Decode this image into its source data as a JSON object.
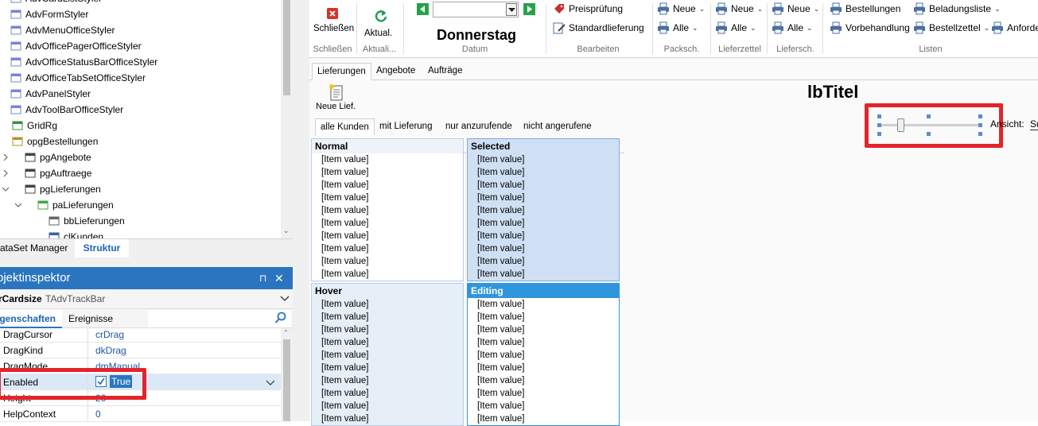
{
  "tree": {
    "items": [
      {
        "label": "AdvCardListStyler",
        "icon": "component-icon"
      },
      {
        "label": "AdvFormStyler",
        "icon": "component-icon"
      },
      {
        "label": "AdvMenuOfficeStyler",
        "icon": "component-icon"
      },
      {
        "label": "AdvOfficePagerOfficeStyler",
        "icon": "component-icon"
      },
      {
        "label": "AdvOfficeStatusBarOfficeStyler",
        "icon": "component-icon"
      },
      {
        "label": "AdvOfficeTabSetOfficeStyler",
        "icon": "component-icon"
      },
      {
        "label": "AdvPanelStyler",
        "icon": "component-icon"
      },
      {
        "label": "AdvToolBarOfficeStyler",
        "icon": "component-icon"
      },
      {
        "label": "GridRg",
        "icon": "grid-icon"
      },
      {
        "label": "opgBestellungen",
        "icon": "pager-icon"
      },
      {
        "label": "pgAngebote",
        "icon": "page-icon"
      },
      {
        "label": "pgAuftraege",
        "icon": "page-icon"
      },
      {
        "label": "pgLieferungen",
        "icon": "page-icon"
      },
      {
        "label": "paLieferungen",
        "icon": "panel-icon"
      },
      {
        "label": "bbLieferungen",
        "icon": "buttonbar-icon"
      },
      {
        "label": "clKunden",
        "icon": "list-icon"
      }
    ],
    "tabs": {
      "datasets": "ataSet Manager",
      "structure": "Struktur"
    }
  },
  "inspector": {
    "title": "bjektinspektor",
    "pin": "⊓",
    "close": "✕",
    "selected_name": "rCardsize",
    "selected_type": "TAdvTrackBar",
    "tabs": {
      "properties": "igenschaften",
      "events": "Ereignisse"
    },
    "properties": [
      {
        "name": "DragCursor",
        "value": "crDrag"
      },
      {
        "name": "DragKind",
        "value": "dkDrag"
      },
      {
        "name": "DragMode",
        "value": "dmManual"
      },
      {
        "name": "Enabled",
        "value": "True"
      },
      {
        "name": "Height",
        "value": "20"
      },
      {
        "name": "HelpContext",
        "value": "0"
      }
    ]
  },
  "ribbon": {
    "close_label": "Schließen",
    "refresh_label": "Aktual.",
    "date_value": "",
    "day_label": "Donnerstag",
    "price_check": "Preisprüfung",
    "standard_delivery": "Standardlieferung",
    "new_label": "Neue",
    "all_label": "Alle",
    "orders": "Bestellungen",
    "pretreatment": "Vorbehandlung",
    "loading_list": "Beladungsliste",
    "order_slip": "Bestellzettel",
    "requirements": "Anforde",
    "groups": {
      "close": "Schließen",
      "refresh": "Aktuali...",
      "date": "Datum",
      "edit": "Bearbeiten",
      "pack": "Packsch.",
      "delivery_note": "Lieferzettel",
      "delivery_slip": "Liefersch.",
      "lists": "Listen"
    }
  },
  "content": {
    "tabs": [
      "Lieferungen",
      "Angebote",
      "Aufträge"
    ],
    "new_delivery": "Neue Lief.",
    "title_label": "lbTitel",
    "filter_tabs": [
      "alle Kunden",
      "mit Lieferung",
      "nur anzurufende",
      "nicht angerufene"
    ],
    "view_label": "Ansicht:",
    "view_value": "Sun",
    "trackbar_position": 0.19,
    "lists": {
      "normal": "Normal",
      "selected": "Selected",
      "hover": "Hover",
      "editing": "Editing"
    },
    "item_value": "[Item value]"
  },
  "colors": {
    "accent": "#2b75c0",
    "highlight_red": "#e3242b",
    "selected_bg": "#cfe0f4",
    "editing_header": "#2f95dd"
  }
}
